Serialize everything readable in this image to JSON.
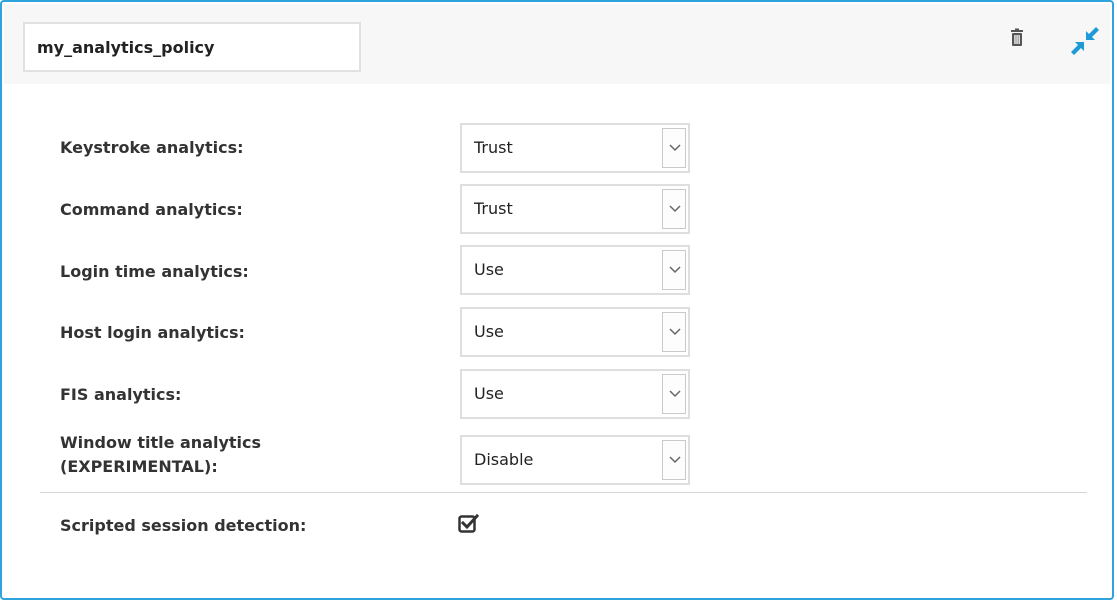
{
  "policy": {
    "name": "my_analytics_policy"
  },
  "header": {
    "delete_icon": "trash-icon",
    "collapse_icon": "compress-arrows-icon",
    "accent_color": "#2ea3dc"
  },
  "settings": [
    {
      "label": "Keystroke analytics:",
      "value": "Trust"
    },
    {
      "label": "Command analytics:",
      "value": "Trust"
    },
    {
      "label": "Login time analytics:",
      "value": "Use"
    },
    {
      "label": "Host login analytics:",
      "value": "Use"
    },
    {
      "label": "FIS analytics:",
      "value": "Use"
    },
    {
      "label": "Window title analytics (EXPERIMENTAL):",
      "label_line1": "Window title analytics",
      "label_line2": "(EXPERIMENTAL):",
      "value": "Disable"
    }
  ],
  "scripted_session": {
    "label": "Scripted session detection:",
    "checked": true
  }
}
